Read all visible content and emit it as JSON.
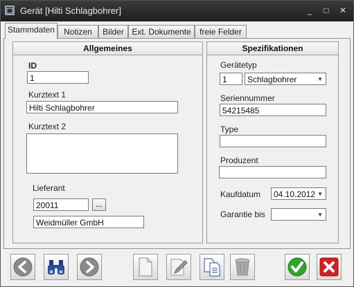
{
  "window": {
    "title": "Gerät [Hilti Schlagbohrer]"
  },
  "window_controls": {
    "minimize": "_",
    "maximize": "□",
    "close": "✕"
  },
  "tabs": [
    {
      "label": "Stammdaten",
      "active": true
    },
    {
      "label": "Notizen",
      "active": false
    },
    {
      "label": "Bilder",
      "active": false
    },
    {
      "label": "Ext. Dokumente",
      "active": false
    },
    {
      "label": "freie Felder",
      "active": false
    }
  ],
  "allgemeines": {
    "header": "Allgemeines",
    "id_label": "ID",
    "id_value": "1",
    "kurztext1_label": "Kurztext 1",
    "kurztext1_value": "Hilti Schlagbohrer",
    "kurztext2_label": "Kurztext 2",
    "kurztext2_value": "",
    "lieferant_label": "Lieferant",
    "lieferant_id": "20011",
    "lieferant_browse": "...",
    "lieferant_name": "Weidmüller GmbH"
  },
  "spezifikationen": {
    "header": "Spezifikationen",
    "geraetetyp_label": "Gerätetyp",
    "geraetetyp_id": "1",
    "geraetetyp_value": "Schlagbohrer",
    "seriennummer_label": "Seriennummer",
    "seriennummer_value": "54215485",
    "type_label": "Type",
    "type_value": "",
    "produzent_label": "Produzent",
    "produzent_value": "",
    "kaufdatum_label": "Kaufdatum",
    "kaufdatum_value": "04.10.2012",
    "garantie_label": "Garantie bis",
    "garantie_value": ""
  },
  "toolbar": {
    "icons": [
      "back-arrow-icon",
      "binoculars-icon",
      "forward-arrow-icon",
      "new-document-icon",
      "edit-pencil-icon",
      "copy-documents-icon",
      "trash-can-icon",
      "check-icon",
      "cancel-x-icon"
    ],
    "colors": {
      "confirm": "#2fa52a",
      "cancel": "#d42020",
      "arrow": "#7d7d7d"
    }
  }
}
